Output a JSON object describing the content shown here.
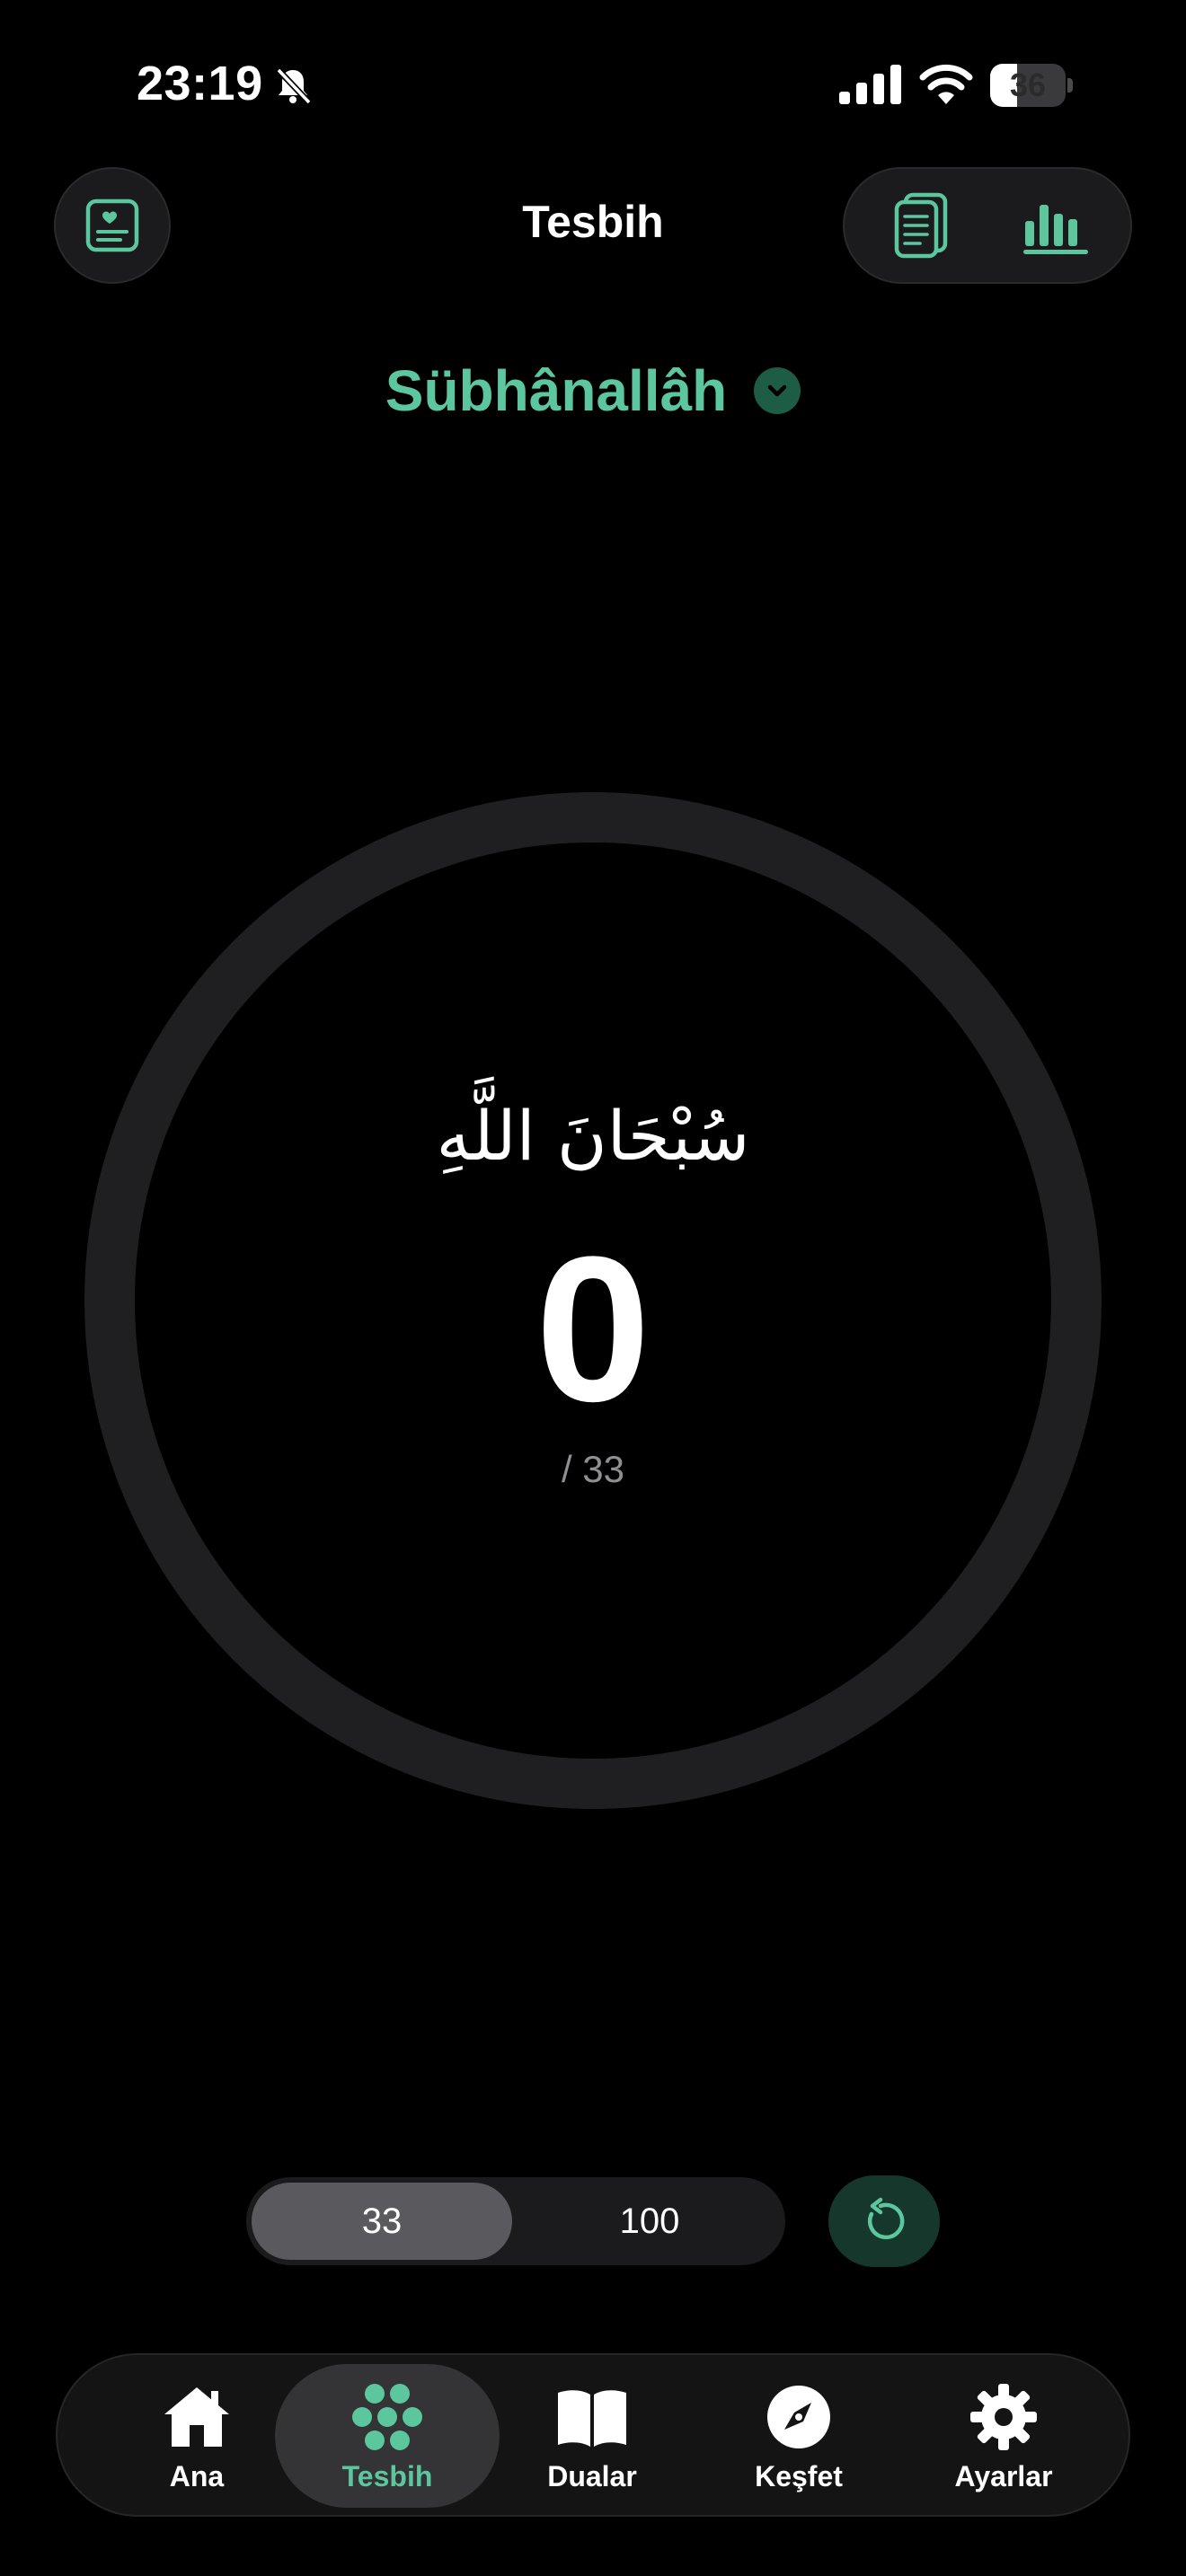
{
  "status_bar": {
    "time": "23:19",
    "battery_level": "36",
    "battery_fraction": 0.36
  },
  "header": {
    "title": "Tesbih",
    "left_button_icon": "heart-note-icon",
    "right_button_icons": [
      "document-icon",
      "bar-chart-icon"
    ]
  },
  "dhikr": {
    "name": "Sübhânallâh",
    "arabic": "سُبْحَانَ اللَّهِ"
  },
  "counter": {
    "count": "0",
    "target": "/ 33",
    "progress": 0
  },
  "target_options": {
    "options": [
      "33",
      "100"
    ],
    "selected": "33"
  },
  "tab_bar": {
    "items": [
      {
        "label": "Ana",
        "icon": "home-icon",
        "active": false
      },
      {
        "label": "Tesbih",
        "icon": "prayer-beads-icon",
        "active": true
      },
      {
        "label": "Dualar",
        "icon": "open-book-icon",
        "active": false
      },
      {
        "label": "Keşfet",
        "icon": "compass-icon",
        "active": false
      },
      {
        "label": "Ayarlar",
        "icon": "gear-icon",
        "active": false
      }
    ]
  },
  "colors": {
    "accent": "#5cc69e",
    "accent_dark": "#1d5c45",
    "background": "#000000",
    "ring": "#1f1f21"
  }
}
